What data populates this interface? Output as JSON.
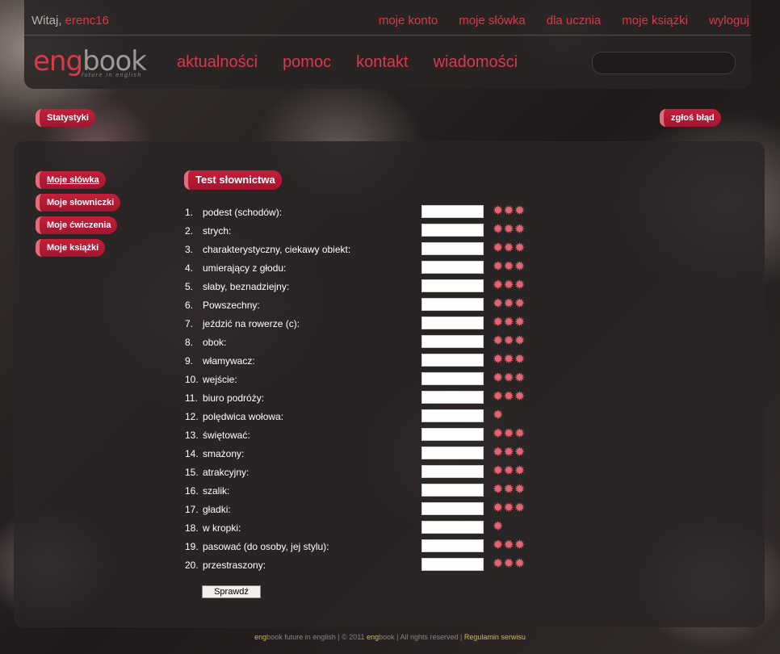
{
  "header": {
    "welcome_prefix": "Witaj, ",
    "username": "erenc16",
    "top_links": [
      "moje konto",
      "moje słówka",
      "dla ucznia",
      "moje książki",
      "wyloguj"
    ],
    "logo_eng": "eng",
    "logo_book": "book",
    "logo_tagline": "future in english",
    "main_nav": [
      "aktualności",
      "pomoc",
      "kontakt",
      "wiadomości"
    ]
  },
  "buttons": {
    "stats": "Statystyki",
    "report": "zgłoś błąd",
    "check": "Sprawdź"
  },
  "side_menu": [
    "Moje słówka",
    "Moje słowniczki",
    "Moje ćwiczenia",
    "Moje książki"
  ],
  "test": {
    "title": "Test słownictwa",
    "words": [
      {
        "num": "1.",
        "label": "podest (schodów):",
        "stars": 3
      },
      {
        "num": "2.",
        "label": "strych:",
        "stars": 3
      },
      {
        "num": "3.",
        "label": "charakterystyczny, ciekawy obiekt:",
        "stars": 3
      },
      {
        "num": "4.",
        "label": "umierający z głodu:",
        "stars": 3
      },
      {
        "num": "5.",
        "label": "słaby, beznadziejny:",
        "stars": 3
      },
      {
        "num": "6.",
        "label": "Powszechny:",
        "stars": 3
      },
      {
        "num": "7.",
        "label": "jeździć na rowerze (c):",
        "stars": 3
      },
      {
        "num": "8.",
        "label": "obok:",
        "stars": 3
      },
      {
        "num": "9.",
        "label": "włamywacz:",
        "stars": 3
      },
      {
        "num": "10.",
        "label": "wejście:",
        "stars": 3
      },
      {
        "num": "11.",
        "label": "biuro podróży:",
        "stars": 3
      },
      {
        "num": "12.",
        "label": "polędwica wołowa:",
        "stars": 1
      },
      {
        "num": "13.",
        "label": "świętować:",
        "stars": 3
      },
      {
        "num": "14.",
        "label": "smażony:",
        "stars": 3
      },
      {
        "num": "15.",
        "label": "atrakcyjny:",
        "stars": 3
      },
      {
        "num": "16.",
        "label": "szalik:",
        "stars": 3
      },
      {
        "num": "17.",
        "label": "gładki:",
        "stars": 3
      },
      {
        "num": "18.",
        "label": "w kropki:",
        "stars": 1
      },
      {
        "num": "19.",
        "label": "pasować (do osoby, jej stylu):",
        "stars": 3
      },
      {
        "num": "20.",
        "label": "przestraszony:",
        "stars": 3
      }
    ]
  },
  "footer": {
    "brand_eng": "eng",
    "text_1": "book future in english | © 2011 ",
    "brand_eng_2": "eng",
    "text_2": "book | All rights reserved | ",
    "link": "Regulamin serwisu"
  },
  "colors": {
    "accent": "#d9394d",
    "pill": "#b41a35",
    "star": "#e46572"
  }
}
